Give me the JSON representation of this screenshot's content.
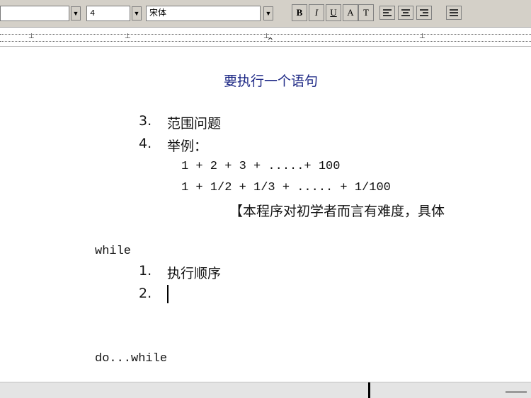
{
  "toolbar": {
    "font_size": "4",
    "font_name": "宋体",
    "buttons": {
      "bold": "B",
      "italic": "I",
      "underline": "U",
      "color": "A",
      "highlight": "T"
    }
  },
  "ruler": {
    "tab_glyph": "⊥"
  },
  "document": {
    "title": "要执行一个语句",
    "items_list1": [
      {
        "num": "3.",
        "text": "范围问题"
      },
      {
        "num": "4.",
        "text": "举例："
      }
    ],
    "formula1": "1 + 2 + 3 + .....+ 100",
    "formula2": "1 + 1/2 + 1/3 + .....  + 1/100",
    "note": "【本程序对初学者而言有难度，具体",
    "while_keyword": "while",
    "items_list2": [
      {
        "num": "1.",
        "text": "执行顺序"
      },
      {
        "num": "2.",
        "text": ""
      }
    ],
    "do_while_keyword": "do...while"
  }
}
